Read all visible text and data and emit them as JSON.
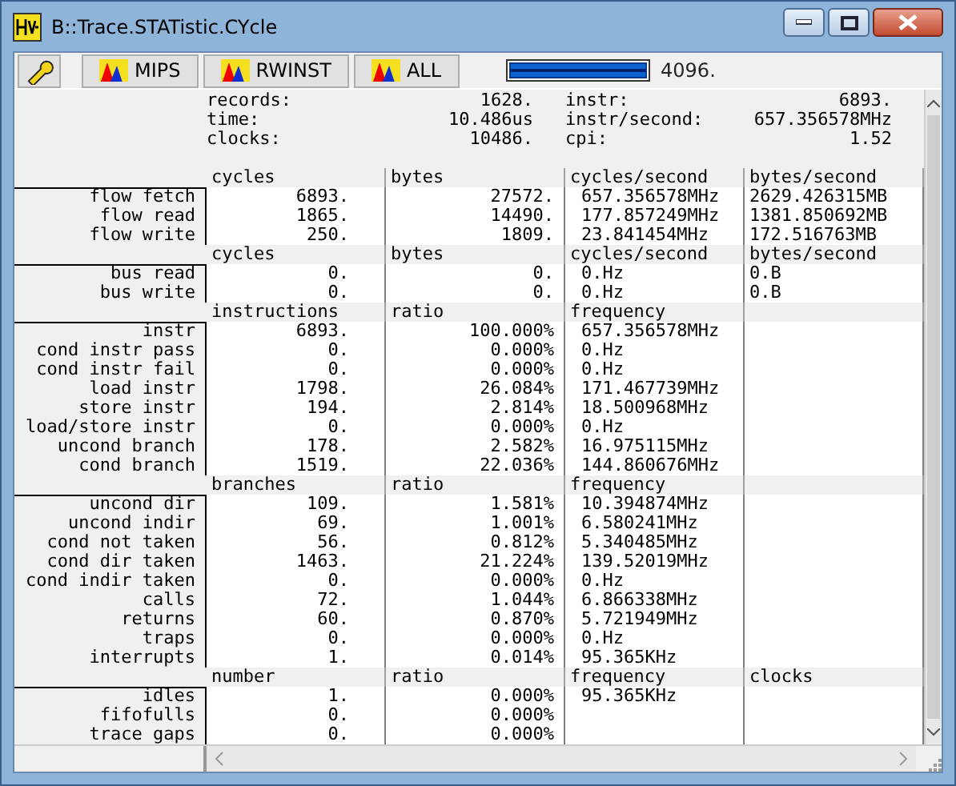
{
  "window": {
    "title": "B::Trace.STATistic.CYcle"
  },
  "toolbar": {
    "buttons": [
      {
        "label": "MIPS"
      },
      {
        "label": "RWINST"
      },
      {
        "label": "ALL"
      }
    ],
    "progress": {
      "level": 1.0,
      "reading": "4096."
    }
  },
  "summary": {
    "left": [
      {
        "label": "records:",
        "value": "1628."
      },
      {
        "label": "time:",
        "value": "10.486us"
      },
      {
        "label": "clocks:",
        "value": "10486."
      }
    ],
    "right": [
      {
        "label": "instr:",
        "value": "6893."
      },
      {
        "label": "instr/second:",
        "value": "657.356578MHz"
      },
      {
        "label": "cpi:",
        "value": "1.52"
      }
    ]
  },
  "sections": [
    {
      "columns": [
        "cycles",
        "bytes",
        "cycles/second",
        "bytes/second"
      ],
      "rows": [
        {
          "label": "flow fetch",
          "values": [
            "6893.",
            "27572.",
            "657.356578MHz",
            "2629.426315MB"
          ]
        },
        {
          "label": "flow read",
          "values": [
            "1865.",
            "14490.",
            "177.857249MHz",
            "1381.850692MB"
          ]
        },
        {
          "label": "flow write",
          "values": [
            "250.",
            "1809.",
            "23.841454MHz",
            "172.516763MB"
          ]
        }
      ]
    },
    {
      "columns": [
        "cycles",
        "bytes",
        "cycles/second",
        "bytes/second"
      ],
      "rows": [
        {
          "label": "bus read",
          "values": [
            "0.",
            "0.",
            "0.Hz",
            "0.B"
          ]
        },
        {
          "label": "bus write",
          "values": [
            "0.",
            "0.",
            "0.Hz",
            "0.B"
          ]
        }
      ]
    },
    {
      "columns": [
        "instructions",
        "ratio",
        "frequency"
      ],
      "rows": [
        {
          "label": "instr",
          "values": [
            "6893.",
            "100.000%",
            "657.356578MHz"
          ]
        },
        {
          "label": "cond instr pass",
          "values": [
            "0.",
            "0.000%",
            "0.Hz"
          ]
        },
        {
          "label": "cond instr fail",
          "values": [
            "0.",
            "0.000%",
            "0.Hz"
          ]
        },
        {
          "label": "load instr",
          "values": [
            "1798.",
            "26.084%",
            "171.467739MHz"
          ]
        },
        {
          "label": "store instr",
          "values": [
            "194.",
            "2.814%",
            "18.500968MHz"
          ]
        },
        {
          "label": "load/store instr",
          "values": [
            "0.",
            "0.000%",
            "0.Hz"
          ]
        },
        {
          "label": "uncond branch",
          "values": [
            "178.",
            "2.582%",
            "16.975115MHz"
          ]
        },
        {
          "label": "cond branch",
          "values": [
            "1519.",
            "22.036%",
            "144.860676MHz"
          ]
        }
      ]
    },
    {
      "columns": [
        "branches",
        "ratio",
        "frequency"
      ],
      "rows": [
        {
          "label": "uncond dir",
          "values": [
            "109.",
            "1.581%",
            "10.394874MHz"
          ]
        },
        {
          "label": "uncond indir",
          "values": [
            "69.",
            "1.001%",
            "6.580241MHz"
          ]
        },
        {
          "label": "cond not taken",
          "values": [
            "56.",
            "0.812%",
            "5.340485MHz"
          ]
        },
        {
          "label": "cond dir taken",
          "values": [
            "1463.",
            "21.224%",
            "139.52019MHz"
          ]
        },
        {
          "label": "cond indir taken",
          "values": [
            "0.",
            "0.000%",
            "0.Hz"
          ]
        },
        {
          "label": "calls",
          "values": [
            "72.",
            "1.044%",
            "6.866338MHz"
          ]
        },
        {
          "label": "returns",
          "values": [
            "60.",
            "0.870%",
            "5.721949MHz"
          ]
        },
        {
          "label": "traps",
          "values": [
            "0.",
            "0.000%",
            "0.Hz"
          ]
        },
        {
          "label": "interrupts",
          "values": [
            "1.",
            "0.014%",
            "95.365KHz"
          ]
        }
      ]
    },
    {
      "columns": [
        "number",
        "ratio",
        "frequency",
        "clocks"
      ],
      "rows": [
        {
          "label": "idles",
          "values": [
            "1.",
            "0.000%",
            "95.365KHz"
          ]
        },
        {
          "label": "fifofulls",
          "values": [
            "0.",
            "0.000%"
          ]
        },
        {
          "label": "trace gaps",
          "values": [
            "0.",
            "0.000%"
          ]
        }
      ]
    }
  ]
}
